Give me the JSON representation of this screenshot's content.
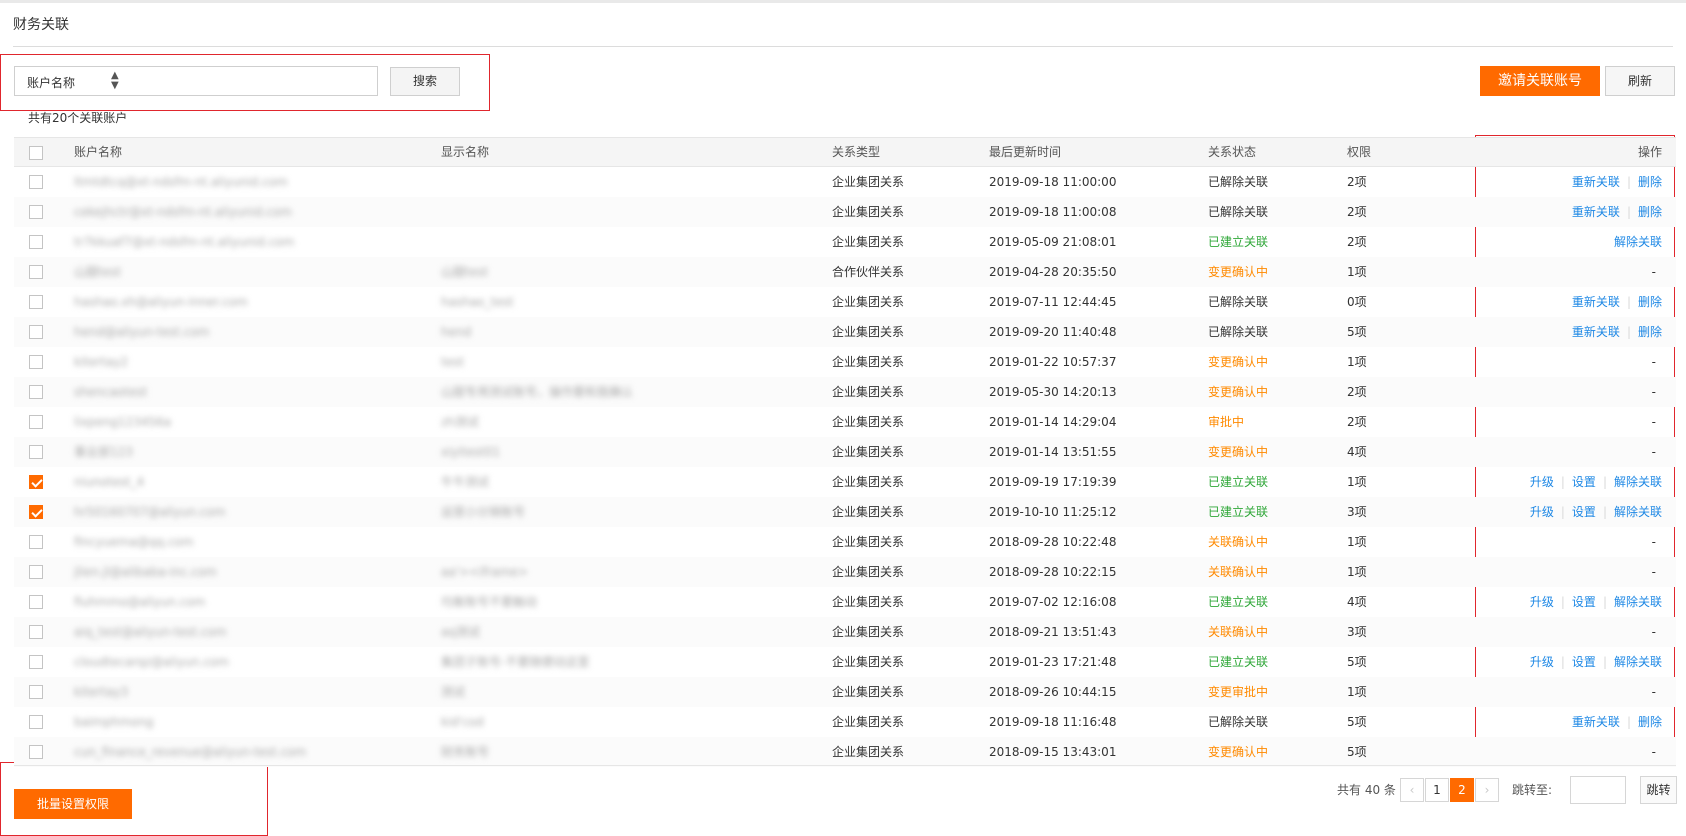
{
  "page": {
    "title": "财务关联"
  },
  "filter": {
    "select_value": "账户名称",
    "search_label": "搜索"
  },
  "actions": {
    "invite_label": "邀请关联账号",
    "refresh_label": "刷新"
  },
  "summary": {
    "count_text": "共有20个关联账户"
  },
  "table": {
    "columns": [
      "账户名称",
      "显示名称",
      "关系类型",
      "最后更新时间",
      "关系状态",
      "权限",
      "操作"
    ],
    "rows": [
      {
        "checked": false,
        "account": "ltmtdtcq@xt-ndsfm-nt.aliyunid.com",
        "display": "",
        "type": "企业集团关系",
        "time": "2019-09-18 11:00:00",
        "status": "已解除关联",
        "status_color": "gray",
        "perm": "2项",
        "ops": [
          "重新关联",
          "删除"
        ]
      },
      {
        "checked": false,
        "account": "cekejhctr@xt-ndsfm-nt.aliyunid.com",
        "display": "",
        "type": "企业集团关系",
        "time": "2019-09-18 11:00:08",
        "status": "已解除关联",
        "status_color": "gray",
        "perm": "2项",
        "ops": [
          "重新关联",
          "删除"
        ]
      },
      {
        "checked": false,
        "account": "tr7kkuaf7@xt-ndsfm-nt.aliyunid.com",
        "display": "",
        "type": "企业集团关系",
        "time": "2019-05-09 21:08:01",
        "status": "已建立关联",
        "status_color": "green",
        "perm": "2项",
        "ops": [
          "解除关联"
        ]
      },
      {
        "checked": false,
        "account": "山甜test",
        "display": "山甜test",
        "type": "合作伙伴关系",
        "time": "2019-04-28 20:35:50",
        "status": "变更确认中",
        "status_color": "orange",
        "perm": "1项",
        "ops": []
      },
      {
        "checked": false,
        "account": "hashao.xh@aliyun-inner.com",
        "display": "hashao_test",
        "type": "企业集团关系",
        "time": "2019-07-11 12:44:45",
        "status": "已解除关联",
        "status_color": "gray",
        "perm": "0项",
        "ops": [
          "重新关联",
          "删除"
        ]
      },
      {
        "checked": false,
        "account": "hend@aliyun-test.com",
        "display": "hend",
        "type": "企业集团关系",
        "time": "2019-09-20 11:40:48",
        "status": "已解除关联",
        "status_color": "gray",
        "perm": "5项",
        "ops": [
          "重新关联",
          "删除"
        ]
      },
      {
        "checked": false,
        "account": "kitertay2",
        "display": "test",
        "type": "企业集团关系",
        "time": "2019-01-22 10:57:37",
        "status": "变更确认中",
        "status_color": "orange",
        "perm": "1项",
        "ops": []
      },
      {
        "checked": false,
        "account": "shencaotest",
        "display": "山甜专用测试账号，操作要和我确认",
        "type": "企业集团关系",
        "time": "2019-05-30 14:20:13",
        "status": "变更确认中",
        "status_color": "orange",
        "perm": "2项",
        "ops": []
      },
      {
        "checked": false,
        "account": "lixpeng123456a",
        "display": "zh测试",
        "type": "企业集团关系",
        "time": "2019-01-14 14:29:04",
        "status": "审批中",
        "status_color": "orange",
        "perm": "2项",
        "ops": []
      },
      {
        "checked": false,
        "account": "事业部123",
        "display": "xiyitest01",
        "type": "企业集团关系",
        "time": "2019-01-14 13:51:55",
        "status": "变更确认中",
        "status_color": "orange",
        "perm": "4项",
        "ops": []
      },
      {
        "checked": true,
        "account": "niunotest_4",
        "display": "牛牛测试",
        "type": "企业集团关系",
        "time": "2019-09-19 17:19:39",
        "status": "已建立关联",
        "status_color": "green",
        "perm": "1项",
        "ops": [
          "升级",
          "设置",
          "解除关联"
        ]
      },
      {
        "checked": true,
        "account": "hr50160707@aliyun.com",
        "display": "运营小分销账号",
        "type": "企业集团关系",
        "time": "2019-10-10 11:25:12",
        "status": "已建立关联",
        "status_color": "green",
        "perm": "3项",
        "ops": [
          "升级",
          "设置",
          "解除关联"
        ]
      },
      {
        "checked": false,
        "account": "fincyuema@qq.com",
        "display": "",
        "type": "企业集团关系",
        "time": "2018-09-28 10:22:48",
        "status": "关联确认中",
        "status_color": "orange",
        "perm": "1项",
        "ops": []
      },
      {
        "checked": false,
        "account": "jlien.jl@alibaba-inc.com",
        "display": "aa'><iframe>",
        "type": "企业集团关系",
        "time": "2018-09-28 10:22:15",
        "status": "关联确认中",
        "status_color": "orange",
        "perm": "1项",
        "ops": []
      },
      {
        "checked": false,
        "account": "fiuhmmo@aliyun.com",
        "display": "均衡账号不要触动",
        "type": "企业集团关系",
        "time": "2019-07-02 12:16:08",
        "status": "已建立关联",
        "status_color": "green",
        "perm": "4项",
        "ops": [
          "升级",
          "设置",
          "解除关联"
        ]
      },
      {
        "checked": false,
        "account": "aiq_test@aliyun-test.com",
        "display": "aq测试",
        "type": "企业集团关系",
        "time": "2018-09-21 13:51:43",
        "status": "关联确认中",
        "status_color": "orange",
        "perm": "3项",
        "ops": []
      },
      {
        "checked": false,
        "account": "cloudtecarqz@aliyun.com",
        "display": "集团子账号-不要随便动这里",
        "type": "企业集团关系",
        "time": "2019-01-23 17:21:48",
        "status": "已建立关联",
        "status_color": "green",
        "perm": "5项",
        "ops": [
          "升级",
          "设置",
          "解除关联"
        ]
      },
      {
        "checked": false,
        "account": "kitertay3",
        "display": "测试",
        "type": "企业集团关系",
        "time": "2018-09-26 10:44:15",
        "status": "变更审批中",
        "status_color": "orange",
        "perm": "1项",
        "ops": []
      },
      {
        "checked": false,
        "account": "baimphmong",
        "display": "kid'cod",
        "type": "企业集团关系",
        "time": "2019-09-18 11:16:48",
        "status": "已解除关联",
        "status_color": "gray",
        "perm": "5项",
        "ops": [
          "重新关联",
          "删除"
        ]
      },
      {
        "checked": false,
        "account": "cun_finance_revenue@aliyun-test.com",
        "display": "财务账号",
        "type": "企业集团关系",
        "time": "2018-09-15 13:43:01",
        "status": "变更确认中",
        "status_color": "orange",
        "perm": "5项",
        "ops": []
      }
    ]
  },
  "footer": {
    "batch_label": "批量设置权限",
    "total_text": "共有 40 条",
    "prev_symbol": "‹",
    "next_symbol": "›",
    "pages": [
      "1",
      "2"
    ],
    "current_page": "2",
    "jump_label": "跳转至:",
    "jump_button": "跳转"
  },
  "colors": {
    "accent": "#ff6a00",
    "link": "#1e88e5",
    "status_green": "#2fa738",
    "status_orange": "#ff8a00",
    "highlight_box": "#e0262d"
  }
}
